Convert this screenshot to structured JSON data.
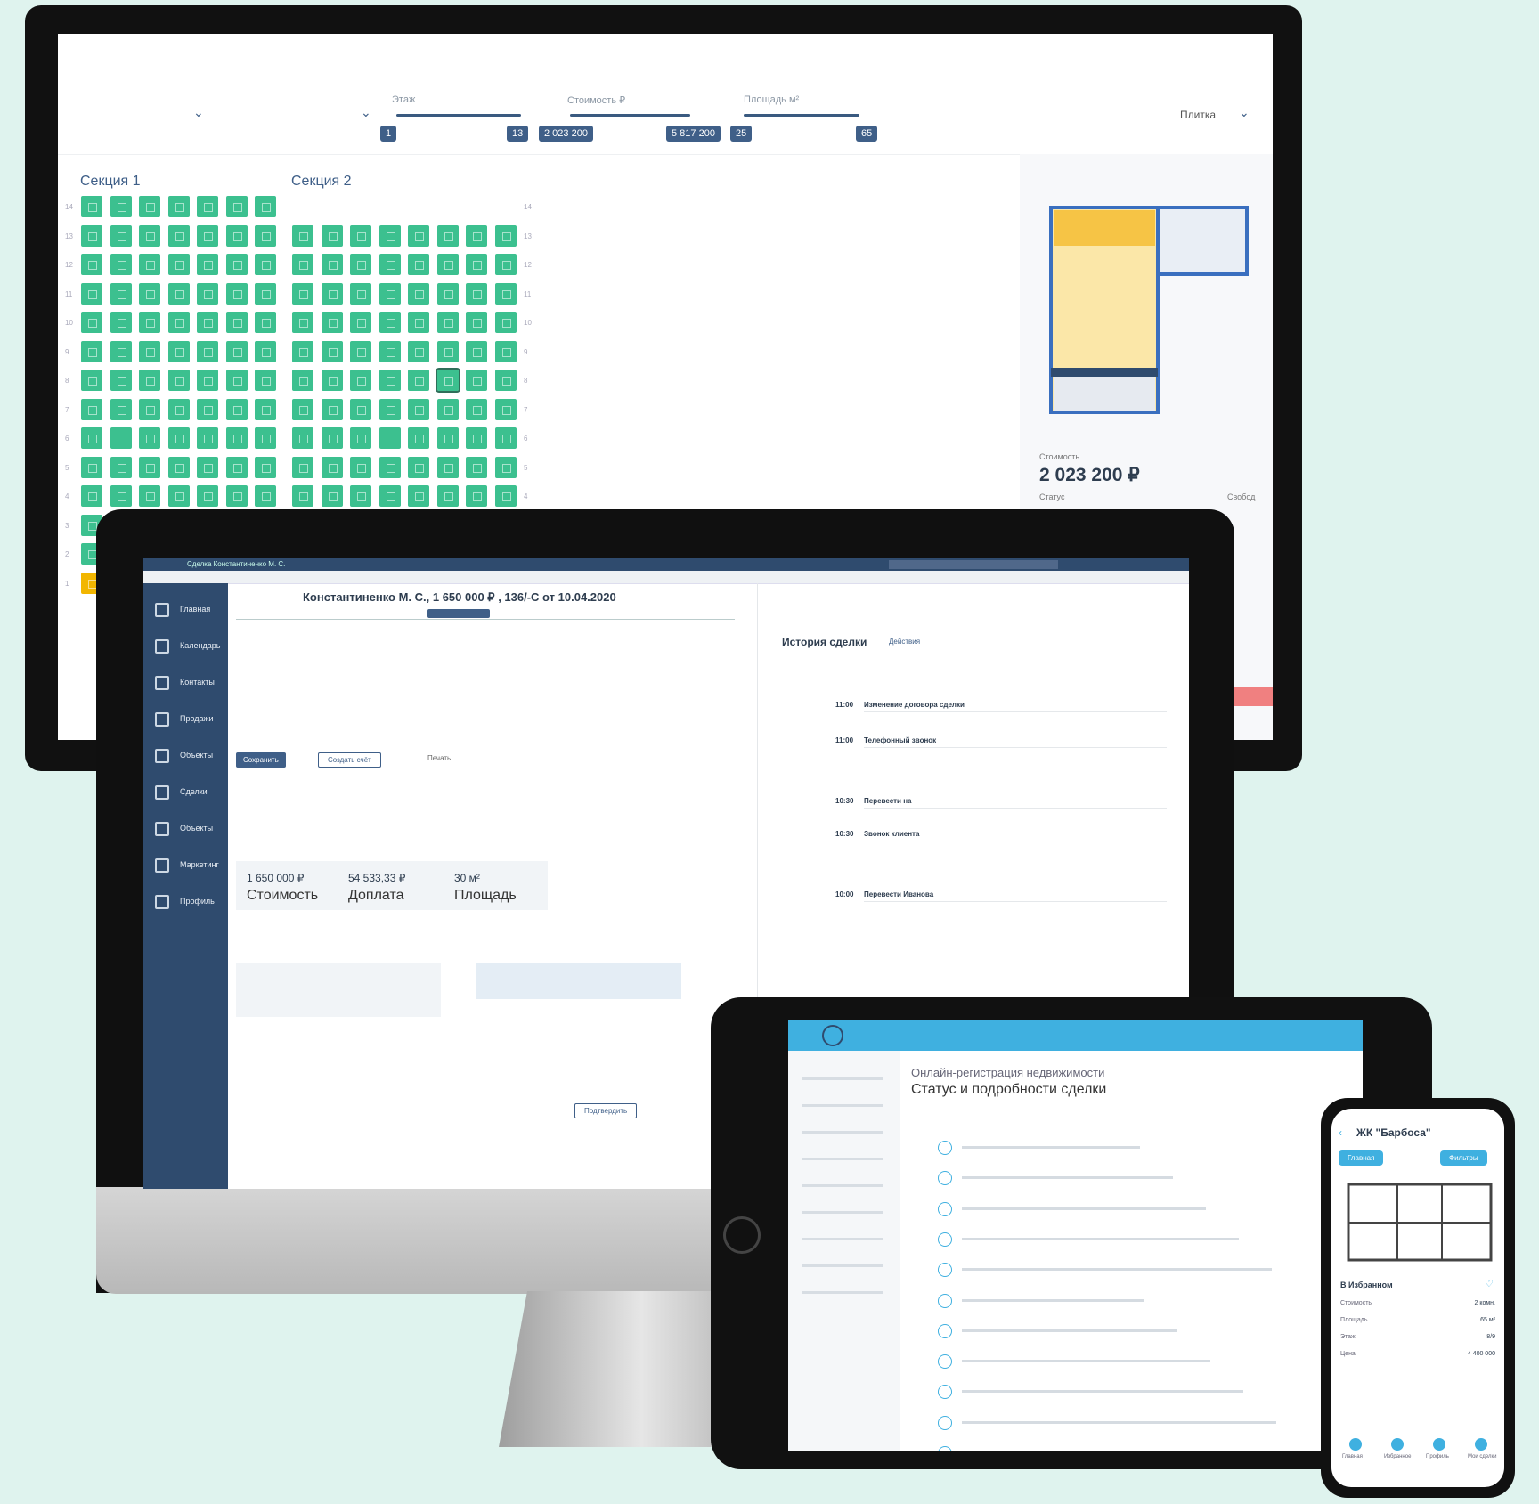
{
  "chessboard": {
    "filters": {
      "floor_label": "Этаж",
      "price_label": "Стоимость ₽",
      "area_label": "Площадь м²",
      "floor_min": "1",
      "floor_max": "13",
      "price_min": "2 023 200",
      "price_max": "5 817 200",
      "area_min": "25",
      "area_max": "65",
      "view_select": "Плитка"
    },
    "section1_title": "Секция 1",
    "section2_title": "Секция 2",
    "floors": [
      "14",
      "13",
      "12",
      "11",
      "10",
      "9",
      "8",
      "7",
      "6",
      "5",
      "4",
      "3",
      "2",
      "1"
    ],
    "detail": {
      "price_label": "Стоимость",
      "price": "2 023 200 ₽",
      "status_label": "Статус",
      "status_right": "Свобод"
    }
  },
  "crm": {
    "titlebar": "Сделка Константиненко М. С.",
    "nav": [
      "Главная",
      "Календарь",
      "Контакты",
      "Продажи",
      "Объекты",
      "Сделки",
      "Объекты",
      "Маркетинг",
      "Профиль"
    ],
    "deal_title": "Константиненко М. С., 1 650 000 ₽ , 136/-С от 10.04.2020",
    "history_title": "История сделки",
    "history_filter": "Действия",
    "save_button": "Сохранить",
    "create_button": "Создать счёт",
    "print_button": "Печать",
    "stat1_value": "1 650 000 ₽",
    "stat1_label": "Стоимость",
    "stat2_value": "54 533,33 ₽",
    "stat2_label": "Доплата",
    "stat3_value": "30 м²",
    "stat3_label": "Площадь",
    "history_time1": "11:00",
    "history_text1": "Изменение договора сделки",
    "history_time2": "11:00",
    "history_text2": "Телефонный звонок",
    "history_time3": "10:30",
    "history_text3": "Перевести на",
    "history_time4": "10:30",
    "history_text4": "Звонок клиента",
    "history_time5": "10:00",
    "history_text5": "Перевести Иванова",
    "confirm_button": "Подтвердить"
  },
  "tablet": {
    "heading": "Онлайн-регистрация недвижимости",
    "subheading": "Статус и подробности сделки",
    "steps_count": 11
  },
  "phone": {
    "title": "ЖК \"Барбоса\"",
    "chip1": "Главная",
    "chip2": "Фильтры",
    "favorite": "В Избранном",
    "rows": [
      {
        "label": "Стоимость",
        "value": "2 комн."
      },
      {
        "label": "Площадь",
        "value": "65 м²"
      },
      {
        "label": "Этаж",
        "value": "8/9"
      },
      {
        "label": "Цена",
        "value": "4 400 000"
      }
    ],
    "tabs": [
      "Главная",
      "Избранное",
      "Профиль",
      "Мои сделки"
    ]
  },
  "colors": {
    "bg": "#dff3ee",
    "free": "#3cc08f",
    "booked": "#f2b600",
    "crm_nav": "#2f4b6e",
    "accent": "#3f5f88"
  }
}
